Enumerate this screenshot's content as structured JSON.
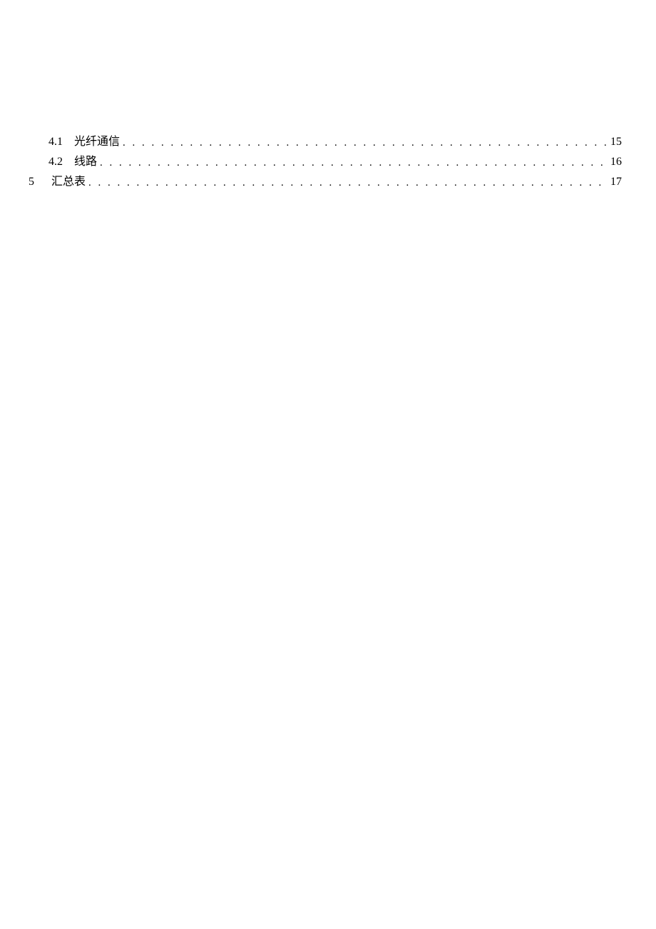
{
  "toc": {
    "entries": [
      {
        "level": 2,
        "number": "4.1",
        "title": "光纤通信",
        "page": "15"
      },
      {
        "level": 2,
        "number": "4.2",
        "title": "线路",
        "page": "16"
      },
      {
        "level": 1,
        "number": "5",
        "title": "汇总表",
        "page": "17"
      }
    ]
  }
}
